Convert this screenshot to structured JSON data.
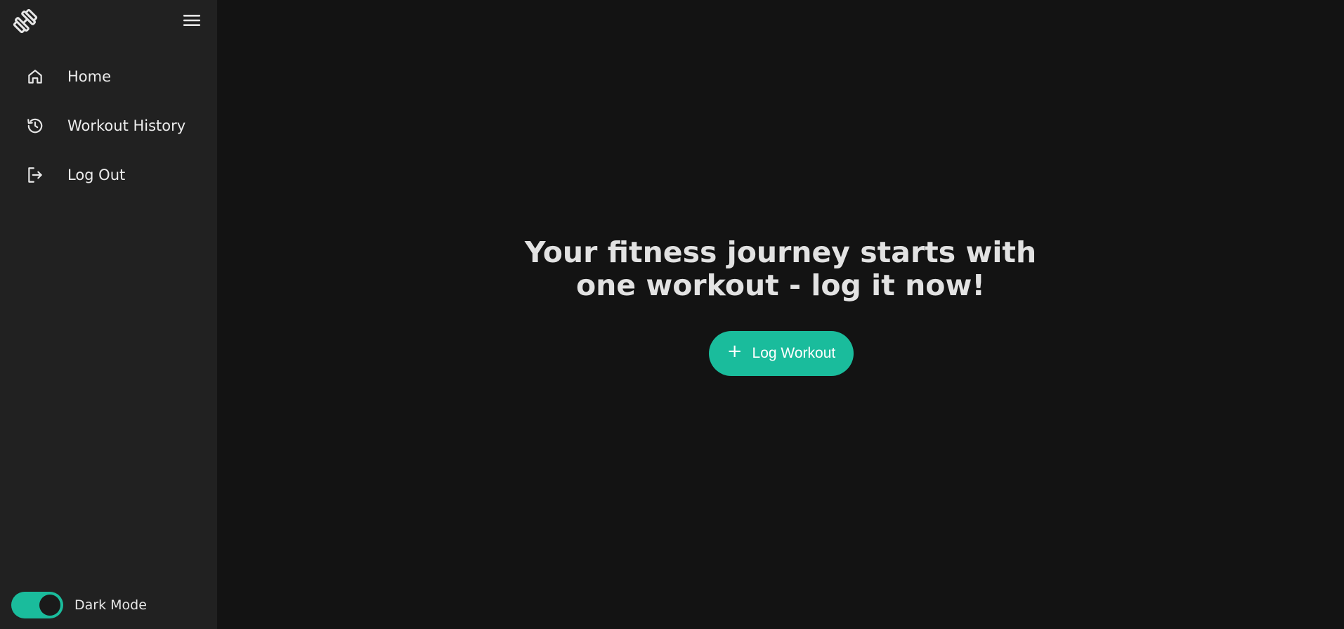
{
  "sidebar": {
    "logo_icon": "dumbbell-icon",
    "menu_icon": "hamburger-menu-icon",
    "items": [
      {
        "label": "Home",
        "icon": "home-icon"
      },
      {
        "label": "Workout History",
        "icon": "history-icon"
      },
      {
        "label": "Log Out",
        "icon": "logout-icon"
      }
    ],
    "dark_mode": {
      "label": "Dark Mode",
      "enabled": true
    }
  },
  "main": {
    "headline_line1": "Your fitness journey starts with",
    "headline_line2": "one workout - log it now!",
    "log_button": {
      "icon": "+",
      "label": "Log Workout"
    }
  },
  "colors": {
    "accent": "#1abc9c",
    "sidebar_bg": "#212121",
    "main_bg": "#131313"
  }
}
